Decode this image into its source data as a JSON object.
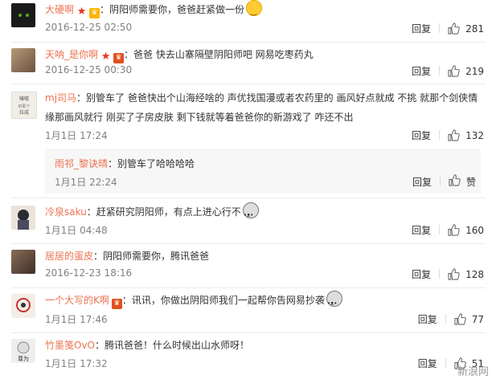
{
  "comments": [
    {
      "user": "大硬啊",
      "content": "：阴阳师需要你，爸爸赶紧做一份",
      "time": "2016-12-25 02:50",
      "reply": "回复",
      "likes": "281"
    },
    {
      "user": "天呐_是你啊",
      "content": "：爸爸 快去山寨隔壁阴阳师吧 网易吃枣药丸",
      "time": "2016-12-25 00:30",
      "reply": "回复",
      "likes": "219"
    },
    {
      "user": "mj司马",
      "content": "：别管车了 爸爸快出个山海经啥的 声优找国漫或者农药里的 画风好点就成 不挑 就那个剑侠情缘那画风就行 刚买了子房皮肤 剩下钱就等着爸爸你的新游戏了 咋还不出",
      "time": "1月1日 17:24",
      "reply": "回复",
      "likes": "132"
    },
    {
      "user": "冷泉saku",
      "content": "：赶紧研究阴阳师，有点上进心行不",
      "time": "1月1日 04:48",
      "reply": "回复",
      "likes": "160"
    },
    {
      "user": "居居的蛋皮",
      "content": "：阴阳师需要你，腾讯爸爸",
      "time": "2016-12-23 18:16",
      "reply": "回复",
      "likes": "128"
    },
    {
      "user": "一个大写的K啊",
      "content": "：讯讯，你做出阴阳师我们一起帮你告网易抄袭",
      "time": "1月1日 17:46",
      "reply": "回复",
      "likes": "77"
    },
    {
      "user": "竹墨笺OvO",
      "content": "：腾讯爸爸！什么时候出山水师呀！",
      "time": "1月1日 17:32",
      "reply": "回复",
      "likes": "51"
    }
  ],
  "subreply": {
    "user": "雨祁_黎诀晴",
    "content": "：别管车了哈哈哈哈",
    "time": "1月1日 22:24",
    "reply": "回复",
    "like_label": "赞"
  },
  "watermark": "新浪网",
  "colors": {
    "username": "#eb7350",
    "time": "#808080",
    "divider": "#ececec"
  }
}
